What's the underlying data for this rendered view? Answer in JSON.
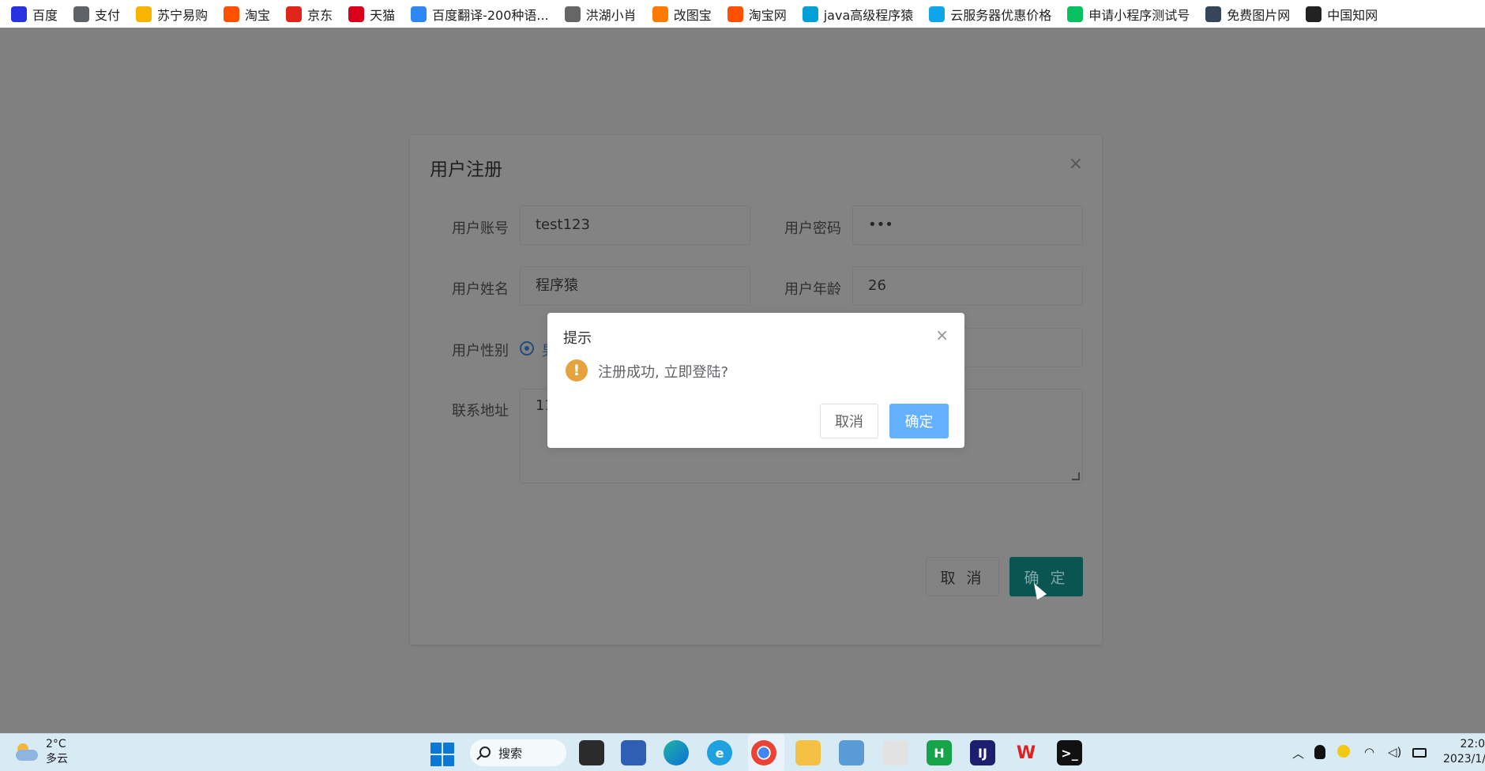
{
  "bookmarks": [
    {
      "label": "百度",
      "icon": "baidu-paw-icon",
      "color": "#2932e1"
    },
    {
      "label": "支付",
      "icon": "globe-icon",
      "color": "#5f6368"
    },
    {
      "label": "苏宁易购",
      "icon": "suning-icon",
      "color": "#f8b500"
    },
    {
      "label": "淘宝",
      "icon": "taobao-icon",
      "color": "#ff5000"
    },
    {
      "label": "京东",
      "icon": "jd-icon",
      "color": "#e1251b"
    },
    {
      "label": "天猫",
      "icon": "tmall-icon",
      "color": "#d9001b"
    },
    {
      "label": "百度翻译-200种语...",
      "icon": "translate-icon",
      "color": "#2d87f3"
    },
    {
      "label": "洪湖小肖",
      "icon": "bird-icon",
      "color": "#666666"
    },
    {
      "label": "改图宝",
      "icon": "image-edit-icon",
      "color": "#ff7a00"
    },
    {
      "label": "淘宝网",
      "icon": "taobao-icon",
      "color": "#ff5000"
    },
    {
      "label": "java高级程序猿",
      "icon": "bilibili-icon",
      "color": "#00a1d6"
    },
    {
      "label": "云服务器优惠价格",
      "icon": "cloud-icon",
      "color": "#0ea5e9"
    },
    {
      "label": "申请小程序测试号",
      "icon": "wechat-icon",
      "color": "#07c160"
    },
    {
      "label": "免费图片网",
      "icon": "t-icon",
      "color": "#35465c"
    },
    {
      "label": "中国知网",
      "icon": "cnki-icon",
      "color": "#222222"
    }
  ],
  "register_dialog": {
    "title": "用户注册",
    "close_glyph": "×",
    "fields": {
      "account": {
        "label": "用户账号",
        "value": "test123"
      },
      "password": {
        "label": "用户密码",
        "value": "•••"
      },
      "name": {
        "label": "用户姓名",
        "value": "程序猿"
      },
      "age": {
        "label": "用户年龄",
        "value": "26"
      },
      "gender": {
        "label": "用户性别",
        "selected": "男"
      },
      "address": {
        "label": "联系地址",
        "value": "11"
      }
    },
    "cancel_label": "取 消",
    "ok_label": "确 定"
  },
  "message_box": {
    "title": "提示",
    "close_glyph": "×",
    "icon_glyph": "!",
    "message": "注册成功, 立即登陆?",
    "cancel_label": "取消",
    "ok_label": "确定"
  },
  "taskbar": {
    "weather": {
      "temp": "2°C",
      "desc": "多云"
    },
    "search_label": "搜索",
    "apps": [
      {
        "icon": "file-explorer-dark-icon",
        "letter": ""
      },
      {
        "icon": "network-computer-icon",
        "letter": ""
      },
      {
        "icon": "edge-icon",
        "letter": ""
      },
      {
        "icon": "ie-browser-icon",
        "letter": "e"
      },
      {
        "icon": "chrome-icon",
        "letter": ""
      },
      {
        "icon": "folder-icon",
        "letter": ""
      },
      {
        "icon": "photos-icon",
        "letter": ""
      },
      {
        "icon": "powerpoint-icon",
        "letter": ""
      },
      {
        "icon": "hbuilder-icon",
        "letter": "H"
      },
      {
        "icon": "intellij-icon",
        "letter": "IJ"
      },
      {
        "icon": "wps-icon",
        "letter": "W"
      },
      {
        "icon": "terminal-icon",
        "letter": ">_"
      }
    ],
    "clock": {
      "time": "22:0",
      "date": "2023/1/"
    }
  },
  "colors": {
    "overlay": "#808080",
    "primary_dim": "#0a5452",
    "confirm_light": "#66b1ff",
    "warning": "#e6a23c"
  }
}
